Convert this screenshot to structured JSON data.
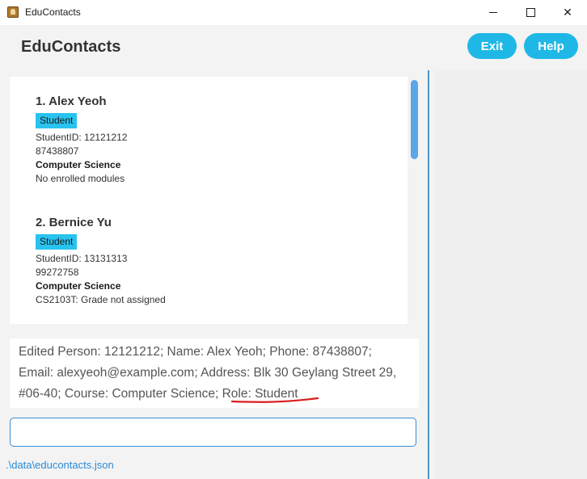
{
  "window": {
    "title": "EduContacts"
  },
  "header": {
    "app_name": "EduContacts",
    "exit_label": "Exit",
    "help_label": "Help"
  },
  "persons": [
    {
      "name": "1. Alex Yeoh",
      "role": "Student",
      "student_id": "StudentID: 12121212",
      "phone": "87438807",
      "course": "Computer Science",
      "modules": "No enrolled modules"
    },
    {
      "name": "2. Bernice Yu",
      "role": "Student",
      "student_id": "StudentID: 13131313",
      "phone": "99272758",
      "course": "Computer Science",
      "modules": "CS2103T: Grade not assigned"
    }
  ],
  "result": {
    "line1": "Edited Person: 12121212; Name: Alex Yeoh; Phone: 87438807;",
    "line2": "Email: alexyeoh@example.com; Address: Blk 30 Geylang Street 29,",
    "line3_prefix": "#06-40; Course: Computer Science; ",
    "line3_role": "Role: Student"
  },
  "command": {
    "value": "",
    "placeholder": ""
  },
  "status": {
    "file_path": ".\\data\\educontacts.json"
  },
  "colors": {
    "accent": "#1fb8e6",
    "role_badge": "#29c3ef",
    "annotation": "#d91c1c",
    "divider": "#4b97c8"
  }
}
